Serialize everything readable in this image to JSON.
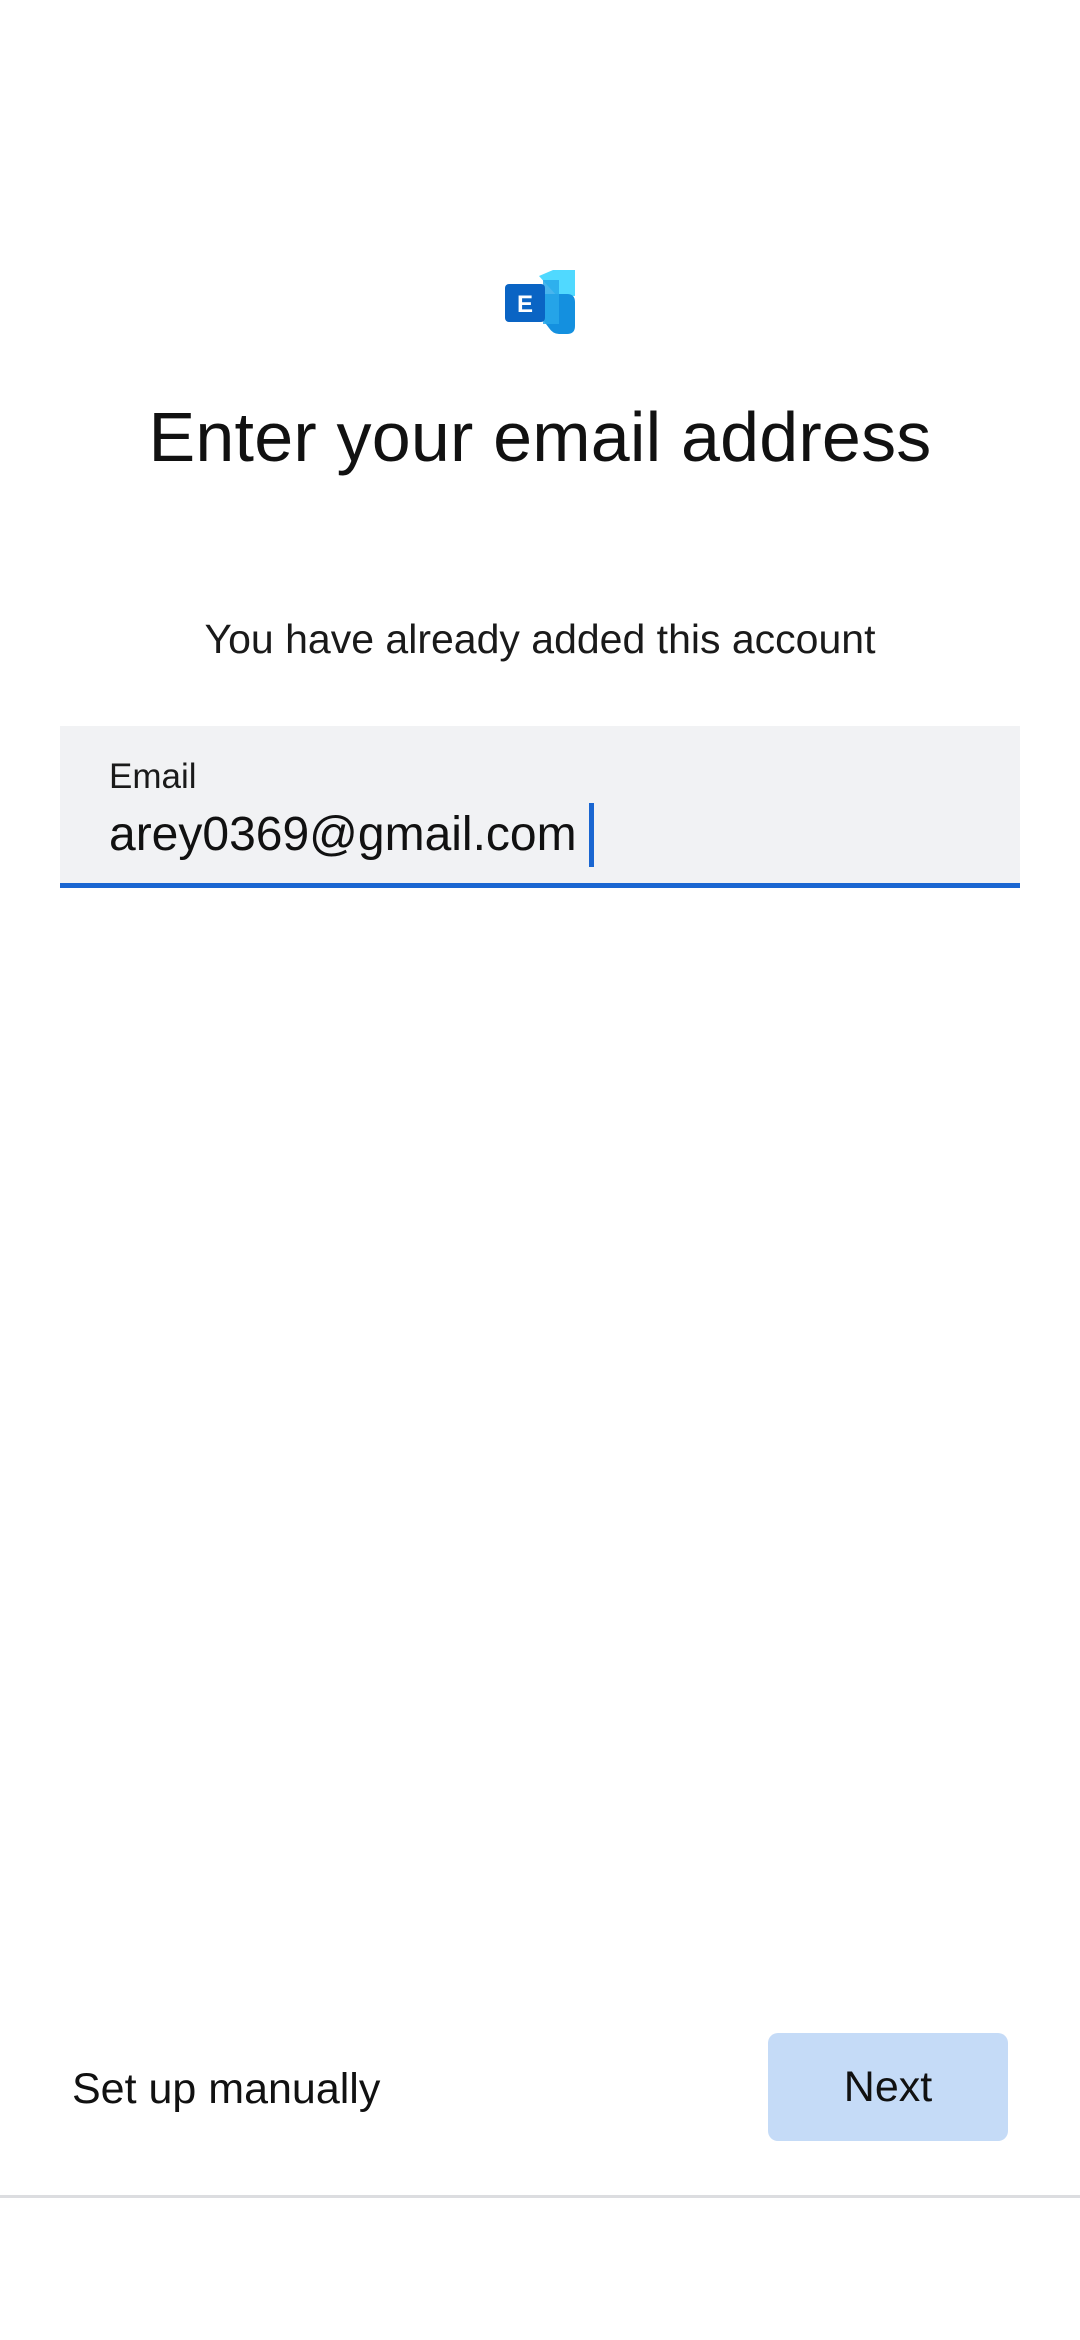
{
  "app": {
    "logo_icon": "exchange-logo-icon",
    "logo_letter": "E",
    "brand_colors": [
      "#28a8ea",
      "#0078d4",
      "#103a7c"
    ]
  },
  "header": {
    "title": "Enter your email address",
    "message": "You have already added this account"
  },
  "email_field": {
    "label": "Email",
    "value": "arey0369@gmail.com"
  },
  "footer": {
    "manual_label": "Set up manually",
    "next_label": "Next"
  },
  "colors": {
    "accent": "#1a66d1",
    "field_background": "#f1f2f4",
    "button_disabled_background": "#c5dbf7"
  }
}
